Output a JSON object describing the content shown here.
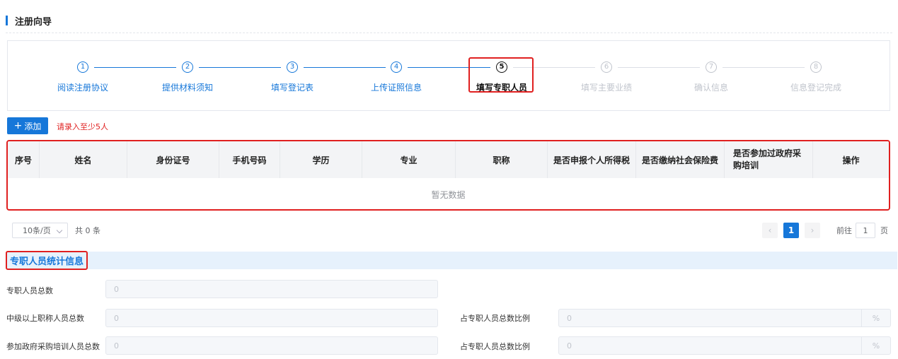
{
  "header": {
    "title": "注册向导"
  },
  "steps": [
    {
      "num": "1",
      "label": "阅读注册协议",
      "state": "done"
    },
    {
      "num": "2",
      "label": "提供材料须知",
      "state": "done"
    },
    {
      "num": "3",
      "label": "填写登记表",
      "state": "done"
    },
    {
      "num": "4",
      "label": "上传证照信息",
      "state": "done"
    },
    {
      "num": "5",
      "label": "填写专职人员",
      "state": "current"
    },
    {
      "num": "6",
      "label": "填写主要业绩",
      "state": "pending"
    },
    {
      "num": "7",
      "label": "确认信息",
      "state": "pending"
    },
    {
      "num": "8",
      "label": "信息登记完成",
      "state": "pending"
    }
  ],
  "toolbar": {
    "add_label": "添加",
    "add_icon": "plus-icon",
    "hint": "请录入至少5人"
  },
  "table": {
    "columns": [
      "序号",
      "姓名",
      "身份证号",
      "手机号码",
      "学历",
      "专业",
      "职称",
      "是否申报个人所得税",
      "是否缴纳社会保险费",
      "是否参加过政府采购培训",
      "操作"
    ],
    "empty_text": "暂无数据"
  },
  "pagination": {
    "page_size": "10条/页",
    "total": "共 0 条",
    "prev_icon": "chevron-left-icon",
    "next_icon": "chevron-right-icon",
    "current_page": "1",
    "goto_label": "前往",
    "goto_value": "1",
    "goto_unit": "页"
  },
  "stats": {
    "title": "专职人员统计信息",
    "total_label": "专职人员总数",
    "total_value": "0",
    "mid_label": "中级以上职称人员总数",
    "mid_value": "0",
    "mid_ratio_label": "占专职人员总数比例",
    "mid_ratio_value": "0",
    "train_label": "参加政府采购培训人员总数",
    "train_value": "0",
    "train_ratio_label": "占专职人员总数比例",
    "train_ratio_value": "0",
    "percent_unit": "%"
  },
  "colors": {
    "primary": "#1677d9",
    "highlight": "#e02020",
    "pending": "#c0c4cc"
  }
}
